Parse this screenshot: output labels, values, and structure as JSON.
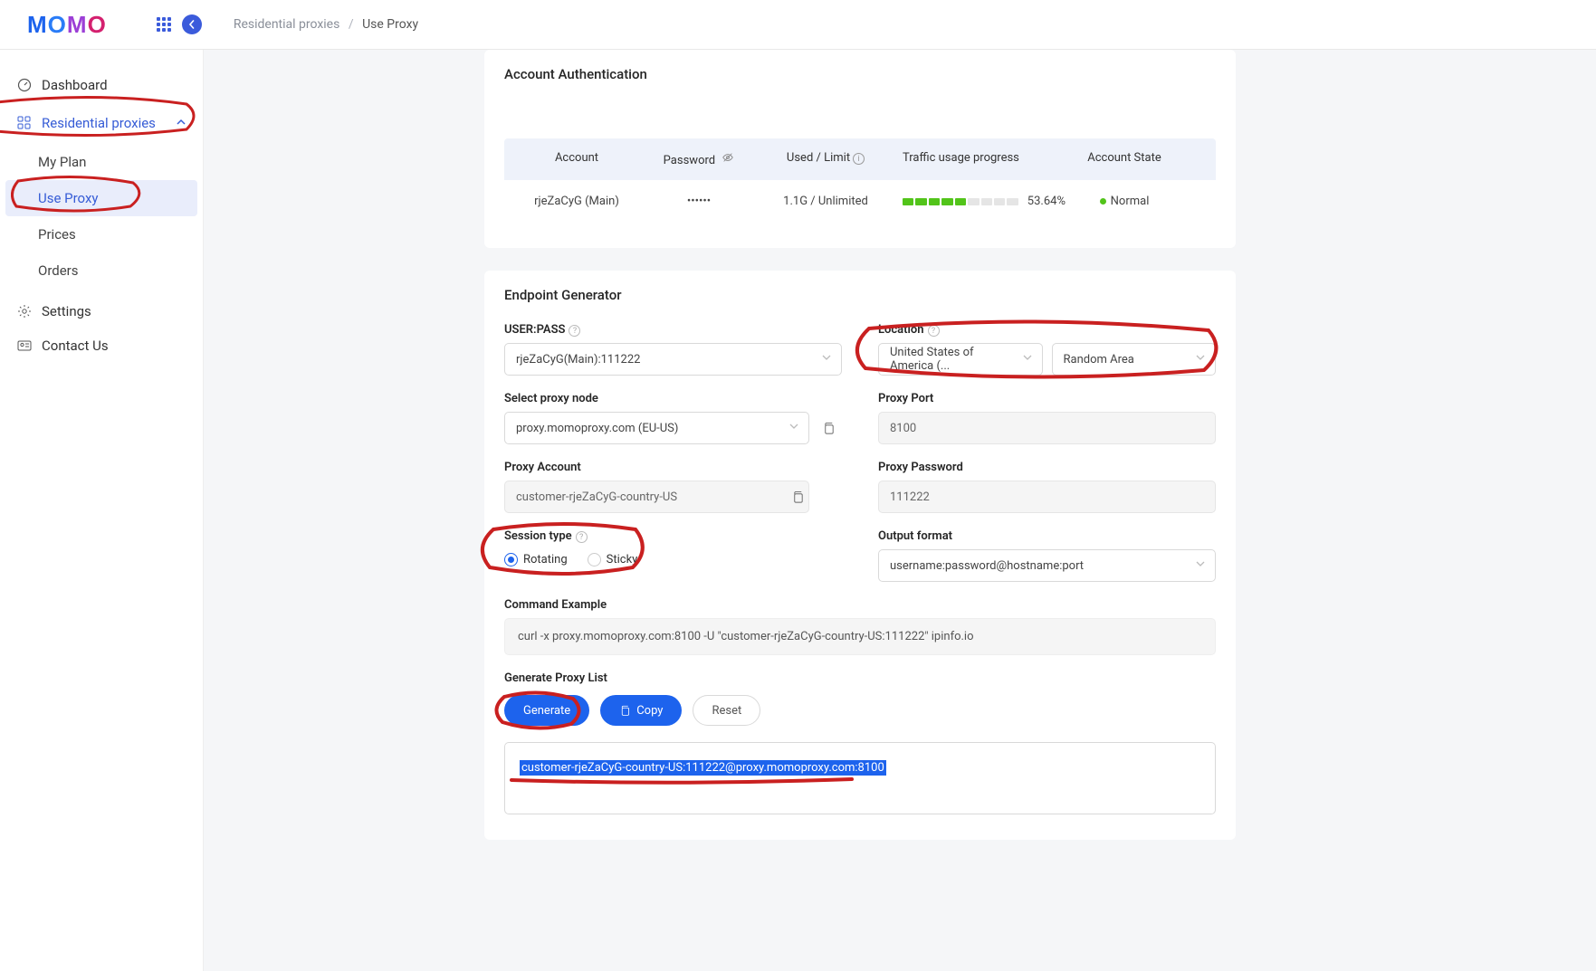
{
  "logo_text": "MOMO",
  "breadcrumb": {
    "parent": "Residential proxies",
    "current": "Use Proxy"
  },
  "sidebar": {
    "dashboard": "Dashboard",
    "res_proxies": "Residential proxies",
    "my_plan": "My Plan",
    "use_proxy": "Use Proxy",
    "prices": "Prices",
    "orders": "Orders",
    "settings": "Settings",
    "contact": "Contact Us"
  },
  "acct_panel": {
    "title": "Account Authentication",
    "head": {
      "account": "Account",
      "password": "Password",
      "used_limit": "Used / Limit",
      "progress": "Traffic usage progress",
      "state": "Account State"
    },
    "row": {
      "account": "rjeZaCyG (Main)",
      "password": "••••••",
      "used_limit": "1.1G / Unlimited",
      "pct": "53.64%",
      "state": "Normal"
    }
  },
  "gen_panel": {
    "title": "Endpoint Generator",
    "userpass_label": "USER:PASS",
    "userpass_value": "rjeZaCyG(Main):111222",
    "location_label": "Location",
    "location_country": "United States of America (...",
    "location_area": "Random Area",
    "node_label": "Select proxy node",
    "node_value": "proxy.momoproxy.com (EU-US)",
    "port_label": "Proxy Port",
    "port_value": "8100",
    "proxy_acc_label": "Proxy Account",
    "proxy_acc_value": "customer-rjeZaCyG-country-US",
    "proxy_pwd_label": "Proxy Password",
    "proxy_pwd_value": "111222",
    "session_label": "Session type",
    "session_rotating": "Rotating",
    "session_sticky": "Sticky",
    "outfmt_label": "Output format",
    "outfmt_value": "username:password@hostname:port",
    "cmd_label": "Command Example",
    "cmd_value": "curl -x proxy.momoproxy.com:8100 -U \"customer-rjeZaCyG-country-US:111222\" ipinfo.io",
    "gen_list_label": "Generate Proxy List",
    "btn_generate": "Generate",
    "btn_copy": "Copy",
    "btn_reset": "Reset",
    "proxy_output": "customer-rjeZaCyG-country-US:111222@proxy.momoproxy.com:8100"
  }
}
